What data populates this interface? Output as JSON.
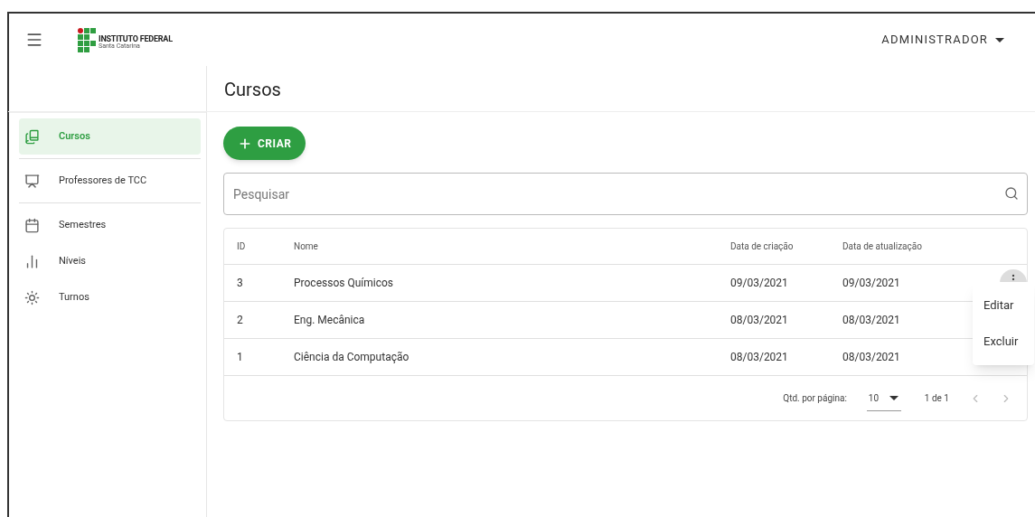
{
  "header": {
    "logo_title": "INSTITUTO FEDERAL",
    "logo_subtitle": "Santa Catarina",
    "user": "ADMINISTRADOR"
  },
  "page_title": "Cursos",
  "sidebar": {
    "items": [
      {
        "label": "Cursos",
        "selected": true
      },
      {
        "label": "Professores de TCC",
        "selected": false
      },
      {
        "label": "Semestres",
        "selected": false
      },
      {
        "label": "Níveis",
        "selected": false
      },
      {
        "label": "Turnos",
        "selected": false
      }
    ]
  },
  "create_button": "CRIAR",
  "search": {
    "placeholder": "Pesquisar"
  },
  "table": {
    "columns": [
      "ID",
      "Nome",
      "Data de criação",
      "Data de atualização"
    ],
    "rows": [
      {
        "cells": [
          "3",
          "Processos Químicos",
          "09/03/2021",
          "09/03/2021"
        ]
      },
      {
        "cells": [
          "2",
          "Eng. Mecânica",
          "08/03/2021",
          "08/03/2021"
        ]
      },
      {
        "cells": [
          "1",
          "Ciência da Computação",
          "08/03/2021",
          "08/03/2021"
        ]
      }
    ]
  },
  "row_menu": [
    "Editar",
    "Excluir"
  ],
  "pagination": {
    "rows_label": "Qtd. por página:",
    "rows_per_page": "10",
    "range": "1 de 1"
  }
}
